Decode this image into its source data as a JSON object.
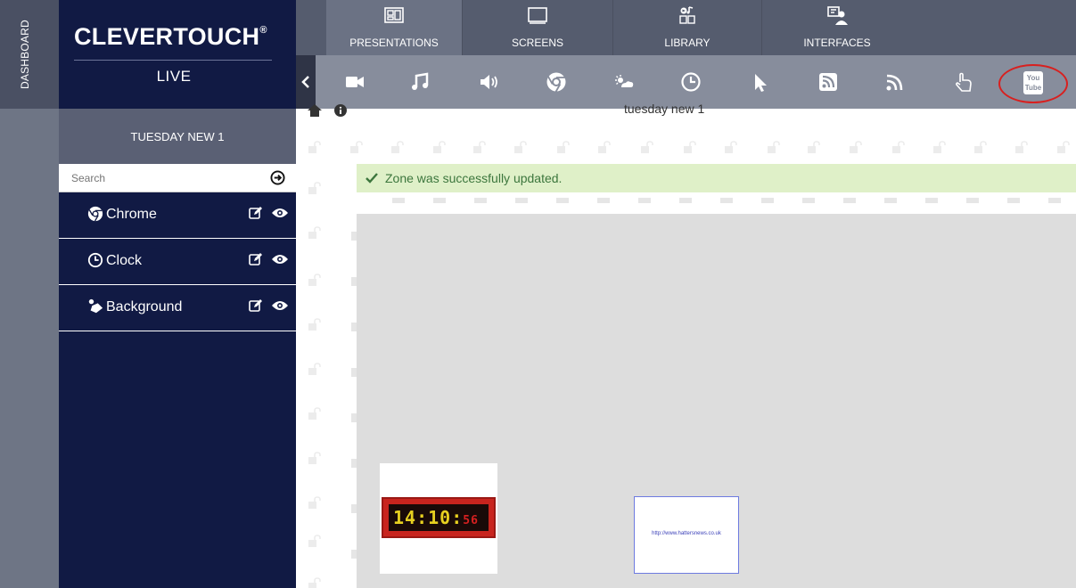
{
  "dashboard": {
    "label": "DASHBOARD"
  },
  "brand": {
    "name": "CLEVERTOUCH",
    "registered": "®",
    "subtitle": "LIVE"
  },
  "presentation": {
    "name": "TUESDAY NEW 1",
    "title": "tuesday new 1"
  },
  "search": {
    "placeholder": "Search",
    "value": ""
  },
  "zones": [
    {
      "label": "Chrome",
      "icon": "chrome-icon"
    },
    {
      "label": "Clock",
      "icon": "clock-icon"
    },
    {
      "label": "Background",
      "icon": "paint-icon"
    }
  ],
  "tabs": [
    {
      "label": "PRESENTATIONS",
      "icon": "presentation-icon",
      "active": true
    },
    {
      "label": "SCREENS",
      "icon": "monitor-icon",
      "active": false
    },
    {
      "label": "LIBRARY",
      "icon": "media-library-icon",
      "active": false
    },
    {
      "label": "INTERFACES",
      "icon": "interfaces-icon",
      "active": false
    }
  ],
  "toolbar": {
    "tools": [
      "back-chevron-icon",
      "video-icon",
      "music-icon",
      "volume-icon",
      "chrome-icon",
      "weather-icon",
      "clock-icon",
      "pointer-icon",
      "rss-box-icon",
      "rss-icon",
      "touch-icon",
      "youtube-icon"
    ],
    "youtube_text_top": "You",
    "youtube_text_bottom": "Tube",
    "highlight_color": "#d8201f"
  },
  "notification": {
    "message": "Zone was successfully updated.",
    "color": "#3c763d",
    "background": "#dff0c8"
  },
  "canvas": {
    "clock_hours": "14",
    "clock_minutes": "10",
    "clock_seconds": "56",
    "chrome_url": "http://www.hattersnews.co.uk"
  },
  "colors": {
    "sidebar": "#111a44",
    "topbar": "#555c6e",
    "toolbar": "#878d9c"
  }
}
